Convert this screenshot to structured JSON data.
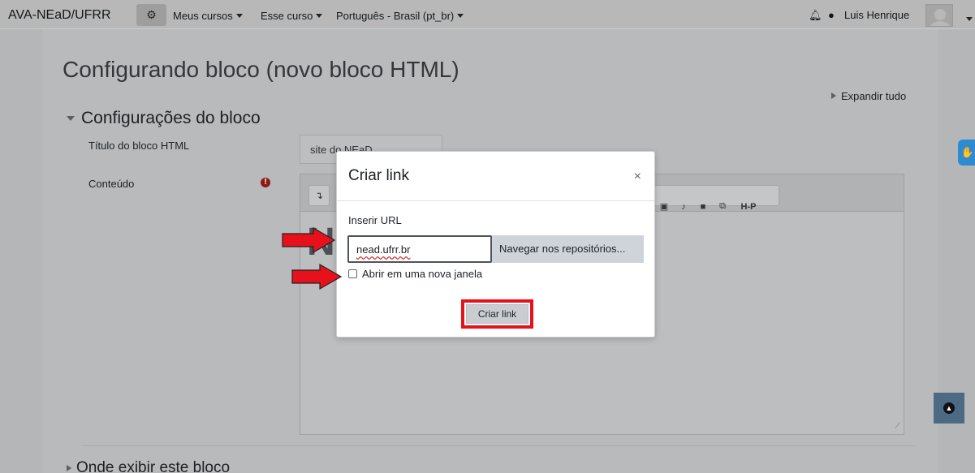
{
  "navbar": {
    "brand": "AVA-NEaD/UFRR",
    "menu": [
      "Meus cursos",
      "Esse curso",
      "Português - Brasil (pt_br)"
    ],
    "username": "Luis Henrique"
  },
  "page": {
    "title": "Configurando bloco (novo bloco HTML)",
    "expand_all": "Expandir tudo",
    "section_title": "Configurações do bloco",
    "title_field_label": "Título do bloco HTML",
    "title_field_value": "site do NEaD",
    "content_label": "Conteúdo",
    "section2_title": "Onde exibir este bloco"
  },
  "modal": {
    "title": "Criar link",
    "close": "×",
    "url_label": "Inserir URL",
    "url_value": "nead.ufrr.br",
    "browse_button": "Navegar nos repositórios...",
    "new_window_label": "Abrir em uma nova janela",
    "new_window_checked": false,
    "create_button": "Criar link"
  },
  "colors": {
    "annotation_red": "#e6111b",
    "accessibility_blue": "#2c8bd1"
  }
}
